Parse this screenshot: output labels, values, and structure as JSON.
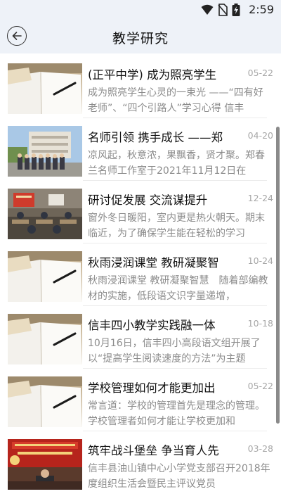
{
  "status": {
    "time": "2:59"
  },
  "header": {
    "title": "教学研究"
  },
  "articles": [
    {
      "title": "(正平中学) 成为照亮学生",
      "date": "05-22",
      "summary": "成为照亮学生心灵的一束光 ——“四有好老师”、“四个引路人”学习心得 信丰",
      "thumb": "notebook"
    },
    {
      "title": "名师引领 携手成长 ——郑",
      "date": "04-20",
      "summary": "凉风起，秋意浓，果飘香，贤才聚。郑春兰名师工作室于2021年11月12日在",
      "thumb": "group-photo"
    },
    {
      "title": "研讨促发展 交流谋提升",
      "date": "12-24",
      "summary": "窗外冬日暖阳，室内更是热火朝天。期末临近，为了确保学生能在轻松的学习",
      "thumb": "classroom"
    },
    {
      "title": "秋雨浸润课堂 教研凝聚智",
      "date": "10-24",
      "summary": "秋雨浸润课堂 教研凝聚智慧　随着部编教材的实施，低段语文识字量递增，",
      "thumb": "notebook"
    },
    {
      "title": "信丰四小教学实践融一体",
      "date": "10-18",
      "summary": "10月16日，信丰四小高段语文组开展了以“提高学生阅读速度的方法”为主题",
      "thumb": "notebook"
    },
    {
      "title": "学校管理如何才能更加出",
      "date": "05-22",
      "summary": "常言道：学校的管理首先是理念的管理。学校管理者如何才能让学校更加和",
      "thumb": "notebook"
    },
    {
      "title": "筑牢战斗堡垒 争当育人先",
      "date": "03-28",
      "summary": "信丰县油山镇中心小学党支部召开2018年度组织生活会暨民主评议党员",
      "thumb": "party-meeting"
    }
  ]
}
